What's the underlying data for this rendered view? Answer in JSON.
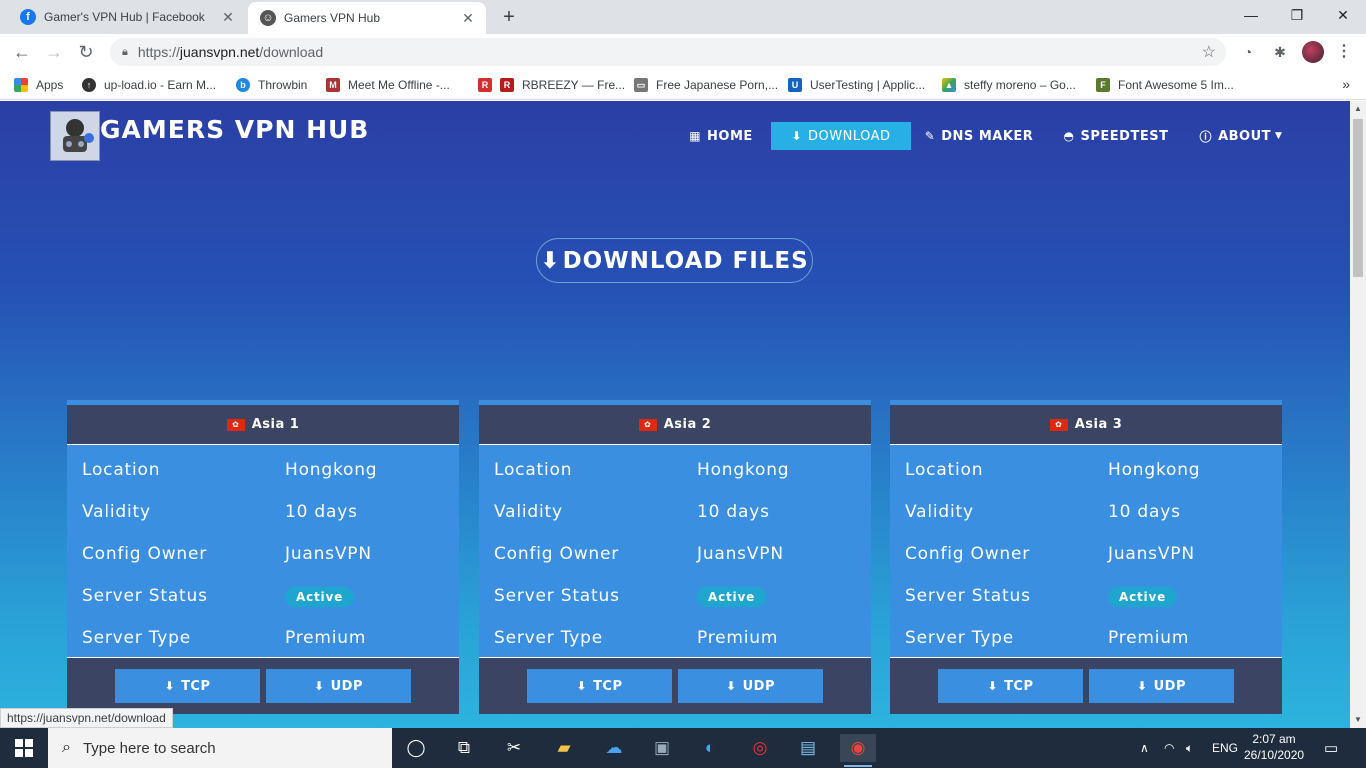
{
  "browser": {
    "tabs": [
      {
        "title": "Gamer's VPN Hub | Facebook",
        "icon": "facebook-icon",
        "active": false
      },
      {
        "title": "Gamers VPN Hub",
        "icon": "site-favicon",
        "active": true
      }
    ],
    "url": {
      "prefix": "https://",
      "host": "juansvpn.net",
      "path": "/download"
    },
    "bookmarks": [
      {
        "label": "Apps",
        "icon": "apps-grid-icon"
      },
      {
        "label": "up-load.io - Earn M...",
        "icon": "upload-icon"
      },
      {
        "label": "Throwbin",
        "icon": "throwbin-icon"
      },
      {
        "label": "Meet Me Offline -...",
        "icon": "meetme-icon"
      },
      {
        "label": "RBREEZY — Fre...",
        "icon": "rbreezy-icon"
      },
      {
        "label": "Free Japanese Porn,...",
        "icon": "page-icon"
      },
      {
        "label": "UserTesting | Applic...",
        "icon": "usertesting-icon"
      },
      {
        "label": "steffy moreno – Go...",
        "icon": "drive-icon"
      },
      {
        "label": "Font Awesome 5 Im...",
        "icon": "fontawesome-icon"
      }
    ],
    "status_url": "https://juansvpn.net/download"
  },
  "site": {
    "brand": "GAMERS VPN HUB",
    "nav": [
      {
        "label": "HOME",
        "icon": "grid-icon",
        "active": false
      },
      {
        "label": "DOWNLOAD",
        "icon": "download-icon",
        "active": true
      },
      {
        "label": "DNS MAKER",
        "icon": "edit-icon",
        "active": false
      },
      {
        "label": "SPEEDTEST",
        "icon": "speedometer-icon",
        "active": false
      },
      {
        "label": "ABOUT",
        "icon": "info-icon",
        "active": false
      }
    ],
    "hero_button": "DOWNLOAD FILES"
  },
  "cards": [
    {
      "title": "Asia 1",
      "location": "Hongkong",
      "validity": "10 days",
      "owner": "JuansVPN",
      "status": "Active",
      "type": "Premium"
    },
    {
      "title": "Asia 2",
      "location": "Hongkong",
      "validity": "10 days",
      "owner": "JuansVPN",
      "status": "Active",
      "type": "Premium"
    },
    {
      "title": "Asia 3",
      "location": "Hongkong",
      "validity": "10 days",
      "owner": "JuansVPN",
      "status": "Active",
      "type": "Premium"
    }
  ],
  "labels": {
    "location": "Location",
    "validity": "Validity",
    "owner": "Config Owner",
    "status": "Server Status",
    "type": "Server Type",
    "tcp": "TCP",
    "udp": "UDP"
  },
  "taskbar": {
    "search_placeholder": "Type here to search",
    "language": "ENG",
    "time": "2:07 am",
    "date": "26/10/2020"
  },
  "colors": {
    "accent": "#28b0e6",
    "card_body": "#3a8fe0",
    "card_header": "#3b4563",
    "badge": "#1fa6cf"
  }
}
